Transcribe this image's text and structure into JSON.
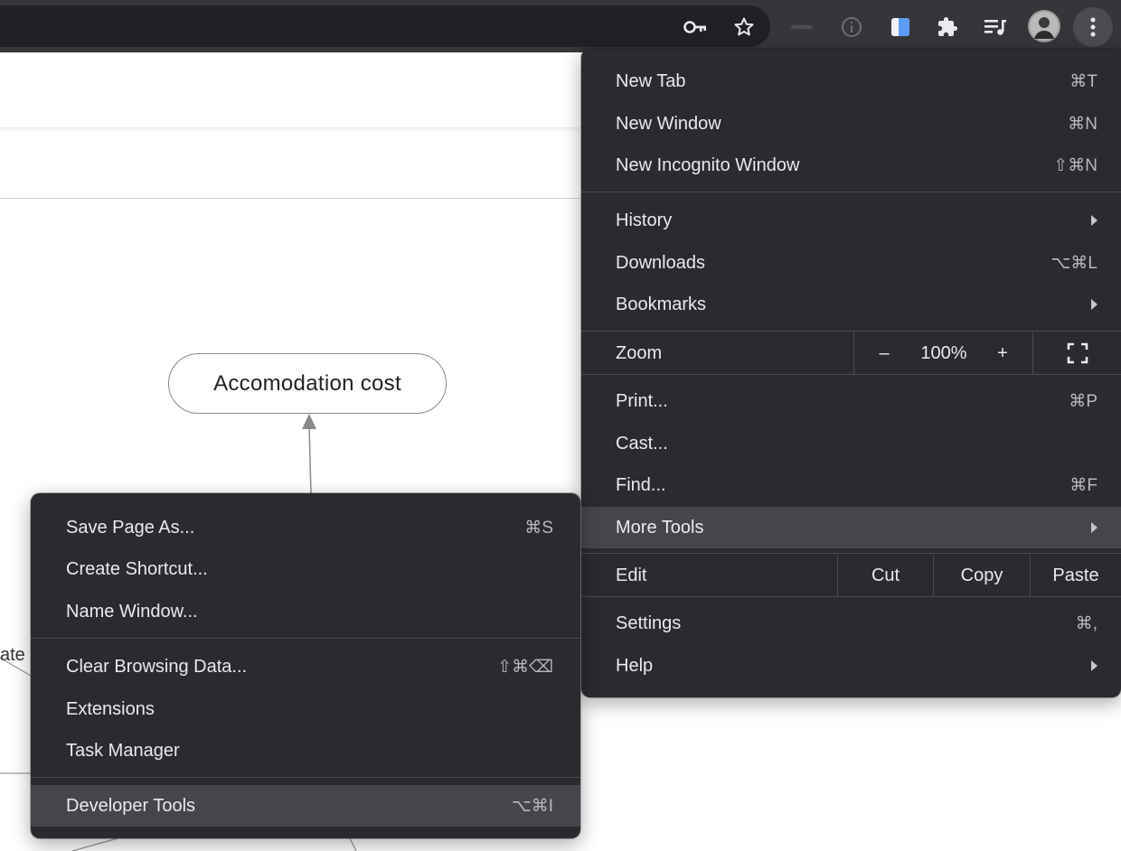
{
  "toolbar": {
    "icons": [
      "key-icon",
      "star-icon",
      "info-icon",
      "notes-extension-icon",
      "puzzle-icon",
      "media-queue-icon",
      "avatar",
      "kebab-menu-icon"
    ]
  },
  "diagram": {
    "node_label": "Accomodation cost",
    "cut_label": "ate"
  },
  "main_menu": {
    "new_tab": {
      "label": "New Tab",
      "shortcut": "⌘T"
    },
    "new_window": {
      "label": "New Window",
      "shortcut": "⌘N"
    },
    "new_incognito": {
      "label": "New Incognito Window",
      "shortcut": "⇧⌘N"
    },
    "history": {
      "label": "History"
    },
    "downloads": {
      "label": "Downloads",
      "shortcut": "⌥⌘L"
    },
    "bookmarks": {
      "label": "Bookmarks"
    },
    "zoom": {
      "label": "Zoom",
      "minus": "–",
      "value": "100%",
      "plus": "+"
    },
    "print": {
      "label": "Print...",
      "shortcut": "⌘P"
    },
    "cast": {
      "label": "Cast..."
    },
    "find": {
      "label": "Find...",
      "shortcut": "⌘F"
    },
    "more_tools": {
      "label": "More Tools"
    },
    "edit": {
      "label": "Edit",
      "cut": "Cut",
      "copy": "Copy",
      "paste": "Paste"
    },
    "settings": {
      "label": "Settings",
      "shortcut": "⌘,"
    },
    "help": {
      "label": "Help"
    }
  },
  "more_tools_menu": {
    "save_page": {
      "label": "Save Page As...",
      "shortcut": "⌘S"
    },
    "create_shortcut": {
      "label": "Create Shortcut..."
    },
    "name_window": {
      "label": "Name Window..."
    },
    "clear_browsing": {
      "label": "Clear Browsing Data...",
      "shortcut": "⇧⌘⌫"
    },
    "extensions": {
      "label": "Extensions"
    },
    "task_manager": {
      "label": "Task Manager"
    },
    "developer_tools": {
      "label": "Developer Tools",
      "shortcut": "⌥⌘I"
    }
  },
  "colors": {
    "toolbar_bg": "#35363a",
    "menu_bg": "#2a2b2e",
    "menu_highlight": "#45464b",
    "menu_text": "#e8eaed"
  }
}
